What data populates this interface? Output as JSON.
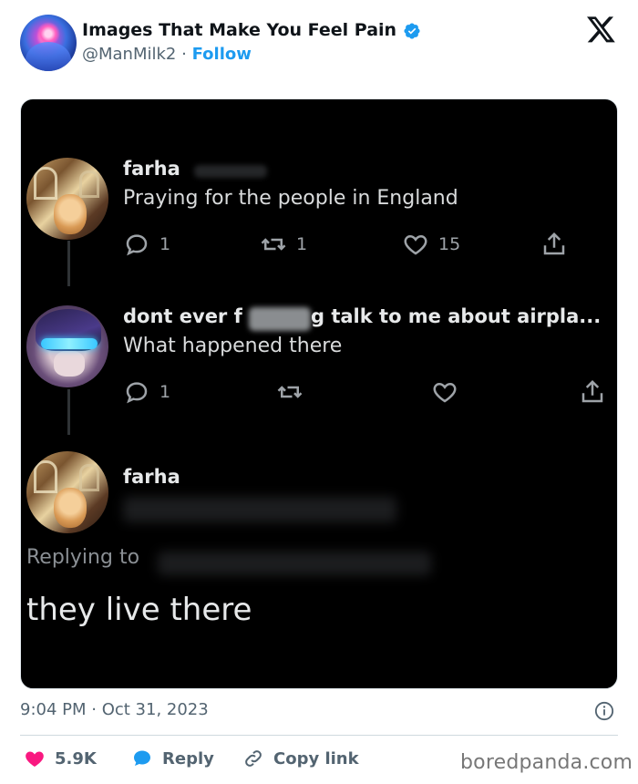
{
  "header": {
    "author_name": "Images That Make You Feel Pain",
    "handle": "@ManMilk2",
    "separator": "·",
    "follow_label": "Follow"
  },
  "embedded": {
    "post1": {
      "name": "farha",
      "text": "Praying for the people in England",
      "replies": "1",
      "retweets": "1",
      "likes": "15"
    },
    "post2": {
      "name_start": "dont ever f",
      "name_end": "g talk to me about airpla...",
      "text": "What happened there",
      "replies": "1"
    },
    "post3": {
      "name": "farha",
      "replying_to": "Replying to",
      "text": "they live there"
    }
  },
  "footer": {
    "timestamp": "9:04 PM · Oct 31, 2023",
    "likes": "5.9K",
    "reply_label": "Reply",
    "copy_link_label": "Copy link",
    "watermark": "boredpanda.com"
  },
  "colors": {
    "accent": "#1d9bf0",
    "like": "#f91880",
    "text_secondary": "#536471"
  }
}
